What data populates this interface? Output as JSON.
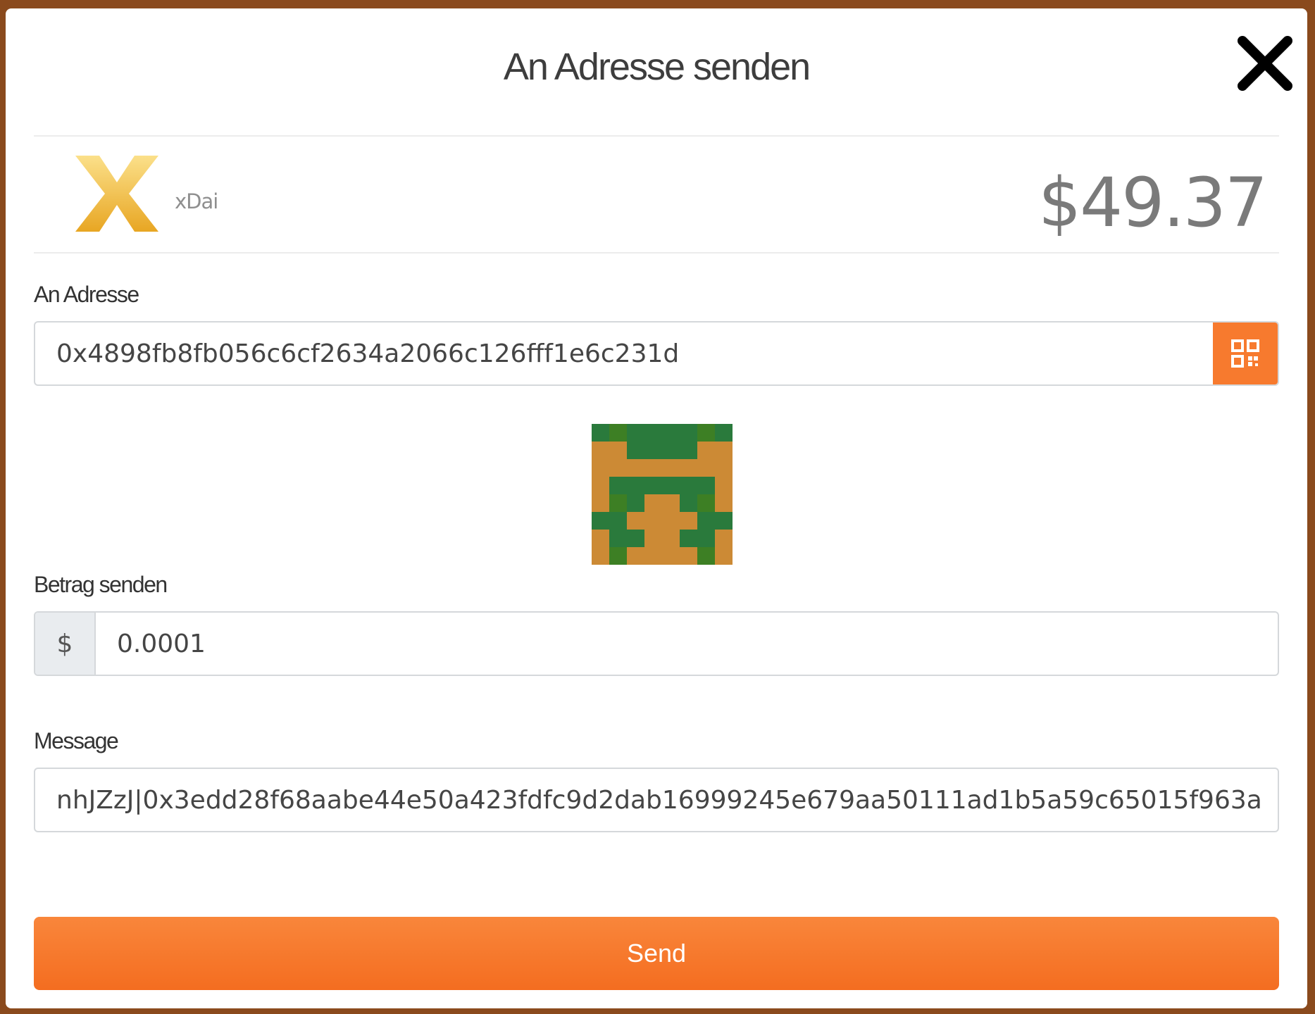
{
  "modal": {
    "title": "An Adresse senden"
  },
  "token": {
    "name": "xDai",
    "balance": "$49.37",
    "logo_colors": [
      "#f9d36a",
      "#e9aa2a"
    ]
  },
  "address": {
    "label": "An Adresse",
    "value": "0x4898fb8fb056c6cf2634a2066c126fff1e6c231d",
    "scan_icon": "qr-code-icon"
  },
  "amount": {
    "label": "Betrag senden",
    "prefix": "$",
    "value": "0.0001"
  },
  "message": {
    "label": "Message",
    "value": "nhJZzJ|0x3edd28f68aabe44e50a423fdfc9d2dab16999245e679aa50111ad1b5a59c65015f963a"
  },
  "actions": {
    "send_label": "Send"
  },
  "colors": {
    "accent": "#f77a2e",
    "blockie_orange": "#cc8a35",
    "blockie_green": "#2a7a3c"
  }
}
